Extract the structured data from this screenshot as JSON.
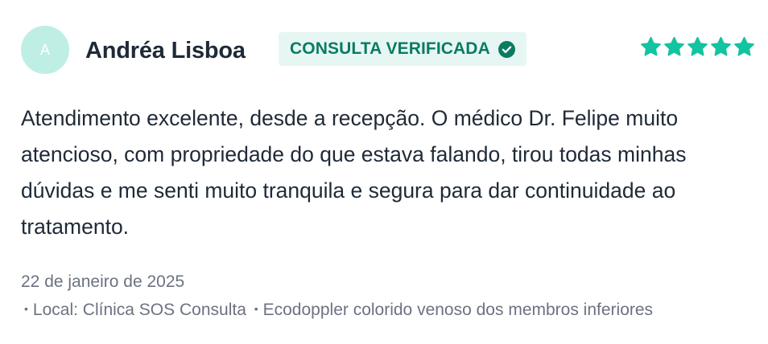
{
  "review": {
    "avatar_initial": "A",
    "author": "Andréa Lisboa",
    "badge_label": "CONSULTA VERIFICADA",
    "rating": 5,
    "rating_max": 5,
    "text": "Atendimento excelente, desde a recepção. O médico Dr. Felipe muito atencioso, com propriedade do que estava falando, tirou todas minhas dúvidas e me senti muito tranquila e segura para dar continuidade ao tratamento.",
    "date": "22 de janeiro de 2025",
    "location": "Local: Clínica SOS Consulta",
    "procedure": "Ecodoppler colorido venoso dos membros inferiores",
    "bullet": "•"
  },
  "icons": {
    "badge": "check-circle-icon",
    "rating": "star-icon"
  },
  "colors": {
    "accent": "#14c3a0",
    "badge_bg": "#e6f7f3",
    "badge_text": "#0b7b62",
    "avatar_bg": "#bfeee5",
    "text": "#1f2a37",
    "muted": "#6b7280"
  }
}
